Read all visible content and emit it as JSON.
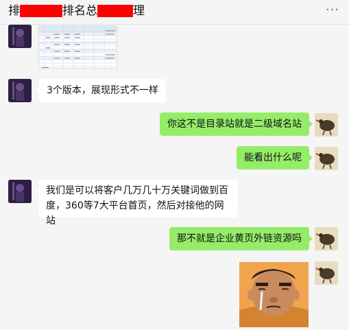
{
  "header": {
    "title_part1": "排",
    "title_part2": "排名总",
    "title_part3": "理",
    "more_icon": "more-dots-icon"
  },
  "messages": [
    {
      "side": "left",
      "type": "image",
      "image": "spreadsheet-thumbnail"
    },
    {
      "side": "left",
      "type": "text",
      "text": "3个版本，展现形式不一样"
    },
    {
      "side": "right",
      "type": "text",
      "text": "你这不是目录站就是二级域名站"
    },
    {
      "side": "right",
      "type": "text",
      "text": "能看出什么呢"
    },
    {
      "side": "left",
      "type": "text",
      "text_line1": "我们是可以将客户几万几十万关键词做到百",
      "text_line2": "度，360等7大平台首页，然后对接他的网站"
    },
    {
      "side": "right",
      "type": "text",
      "text": "那不就是企业黄页外链资源吗"
    },
    {
      "side": "right",
      "type": "image",
      "image": "crying-man-sticker"
    }
  ],
  "colors": {
    "background": "#f5f5f5",
    "bubble_self": "#95ec69",
    "bubble_other": "#ffffff",
    "redaction": "#ff0000"
  }
}
